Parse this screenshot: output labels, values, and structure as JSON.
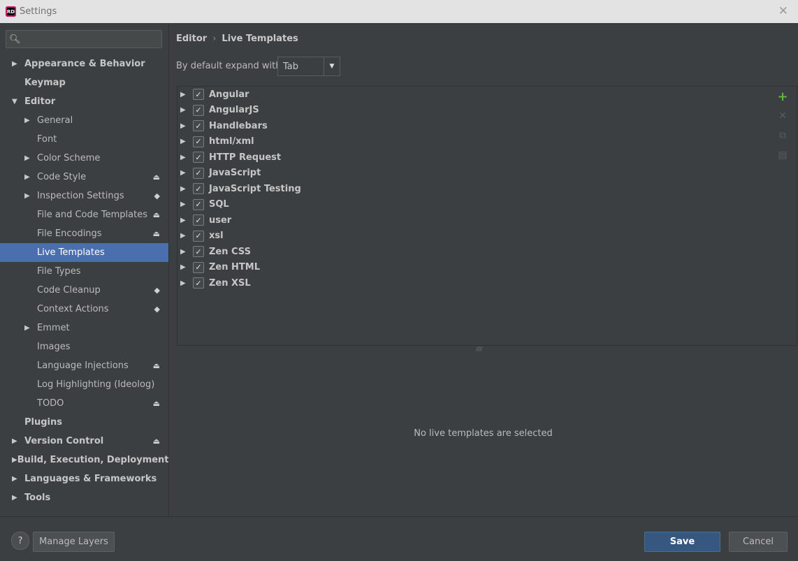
{
  "window": {
    "title": "Settings",
    "icon_text": "RD",
    "close_icon": "close-icon"
  },
  "search": {
    "value": "",
    "placeholder": ""
  },
  "tree": [
    {
      "label": "Appearance & Behavior",
      "level": 0,
      "expandable": true,
      "expanded": false
    },
    {
      "label": "Keymap",
      "level": 0,
      "expandable": false
    },
    {
      "label": "Editor",
      "level": 0,
      "expandable": true,
      "expanded": true
    },
    {
      "label": "General",
      "level": 1,
      "expandable": true
    },
    {
      "label": "Font",
      "level": 1,
      "expandable": false
    },
    {
      "label": "Color Scheme",
      "level": 1,
      "expandable": true
    },
    {
      "label": "Code Style",
      "level": 1,
      "expandable": true,
      "icon": "lock-icon"
    },
    {
      "label": "Inspection Settings",
      "level": 1,
      "expandable": true,
      "icon": "layers-icon"
    },
    {
      "label": "File and Code Templates",
      "level": 1,
      "expandable": false,
      "icon": "lock-icon"
    },
    {
      "label": "File Encodings",
      "level": 1,
      "expandable": false,
      "icon": "lock-icon"
    },
    {
      "label": "Live Templates",
      "level": 1,
      "expandable": false,
      "selected": true
    },
    {
      "label": "File Types",
      "level": 1,
      "expandable": false
    },
    {
      "label": "Code Cleanup",
      "level": 1,
      "expandable": false,
      "icon": "layers-icon"
    },
    {
      "label": "Context Actions",
      "level": 1,
      "expandable": false,
      "icon": "layers-icon"
    },
    {
      "label": "Emmet",
      "level": 1,
      "expandable": true
    },
    {
      "label": "Images",
      "level": 1,
      "expandable": false
    },
    {
      "label": "Language Injections",
      "level": 1,
      "expandable": false,
      "icon": "lock-icon"
    },
    {
      "label": "Log Highlighting (Ideolog)",
      "level": 1,
      "expandable": false
    },
    {
      "label": "TODO",
      "level": 1,
      "expandable": false,
      "icon": "lock-icon"
    },
    {
      "label": "Plugins",
      "level": 0,
      "expandable": false
    },
    {
      "label": "Version Control",
      "level": 0,
      "expandable": true,
      "icon": "lock-icon"
    },
    {
      "label": "Build, Execution, Deployment",
      "level": 0,
      "expandable": true
    },
    {
      "label": "Languages & Frameworks",
      "level": 0,
      "expandable": true
    },
    {
      "label": "Tools",
      "level": 0,
      "expandable": true
    }
  ],
  "breadcrumb": {
    "parent": "Editor",
    "separator": "›",
    "current": "Live Templates"
  },
  "expand_with": {
    "label": "By default expand with",
    "value": "Tab"
  },
  "templates": [
    {
      "label": "Angular",
      "checked": true
    },
    {
      "label": "AngularJS",
      "checked": true
    },
    {
      "label": "Handlebars",
      "checked": true
    },
    {
      "label": "html/xml",
      "checked": true
    },
    {
      "label": "HTTP Request",
      "checked": true
    },
    {
      "label": "JavaScript",
      "checked": true
    },
    {
      "label": "JavaScript Testing",
      "checked": true
    },
    {
      "label": "SQL",
      "checked": true
    },
    {
      "label": "user",
      "checked": true
    },
    {
      "label": "xsl",
      "checked": true
    },
    {
      "label": "Zen CSS",
      "checked": true
    },
    {
      "label": "Zen HTML",
      "checked": true
    },
    {
      "label": "Zen XSL",
      "checked": true
    }
  ],
  "toolbar": {
    "add_icon": "plus-icon",
    "remove_icon": "close-icon",
    "copy_icon": "copy-icon",
    "restore_icon": "restore-icon"
  },
  "empty_message": "No live templates are selected",
  "footer": {
    "help_label": "?",
    "manage_layers": "Manage Layers",
    "save": "Save",
    "cancel": "Cancel"
  },
  "colors": {
    "accent": "#4b6eaf",
    "primary_button": "#365880",
    "add_icon": "#62b543"
  }
}
